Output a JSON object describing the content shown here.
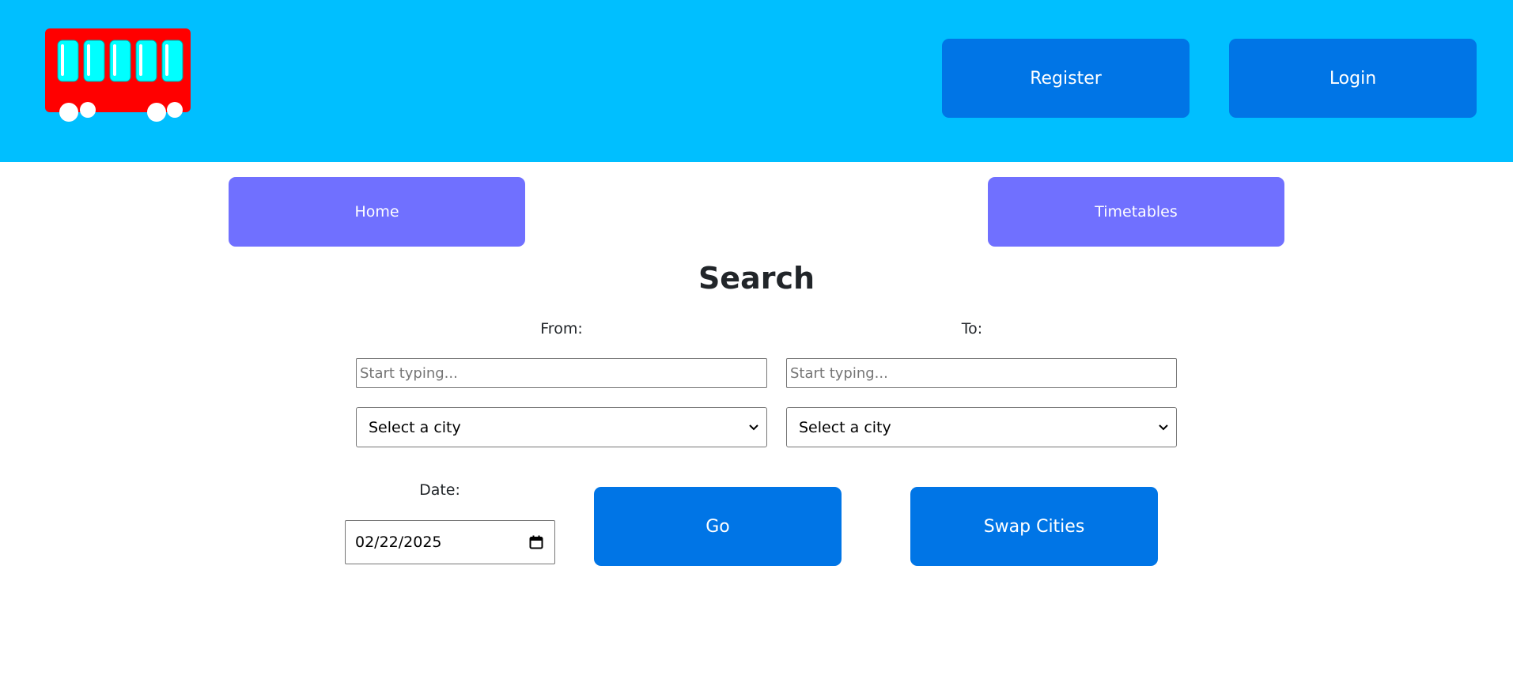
{
  "header": {
    "register_label": "Register",
    "login_label": "Login"
  },
  "nav": {
    "home_label": "Home",
    "timetables_label": "Timetables"
  },
  "search": {
    "title": "Search",
    "from_label": "From:",
    "to_label": "To:",
    "from_placeholder": "Start typing...",
    "to_placeholder": "Start typing...",
    "from_select_value": "Select a city",
    "to_select_value": "Select a city",
    "date_label": "Date:",
    "date_value": "02/22/2025",
    "go_label": "Go",
    "swap_label": "Swap Cities"
  },
  "colors": {
    "header_bg": "#00bfff",
    "primary_button": "#0075e6",
    "nav_button": "#7070ff",
    "logo_bus": "#ff0000",
    "logo_window": "#00ffff"
  },
  "icons": {
    "logo": "bus-logo-icon",
    "select_chevron": "chevron-down-icon",
    "date_picker": "calendar-icon"
  }
}
